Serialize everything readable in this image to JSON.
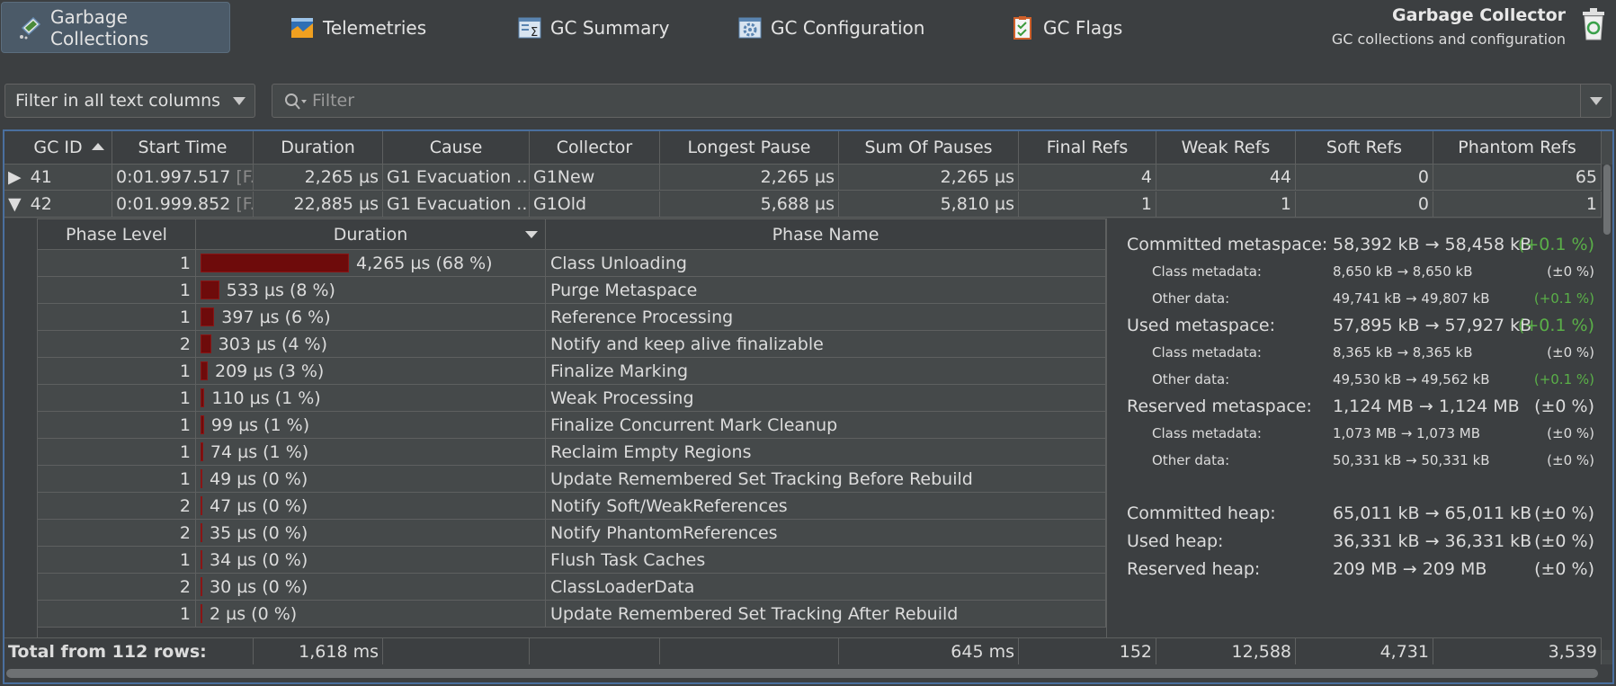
{
  "tabs": [
    {
      "label": "Garbage Collections",
      "icon": "garbage-collections-icon",
      "active": true
    },
    {
      "label": "Telemetries",
      "icon": "telemetries-icon"
    },
    {
      "label": "GC Summary",
      "icon": "gc-summary-icon"
    },
    {
      "label": "GC Configuration",
      "icon": "gc-configuration-icon"
    },
    {
      "label": "GC Flags",
      "icon": "gc-flags-icon"
    }
  ],
  "brand": {
    "title": "Garbage Collector",
    "subtitle": "GC collections and configuration"
  },
  "filter_bar": {
    "mode": "Filter in all text columns",
    "placeholder": "Filter"
  },
  "table": {
    "columns": [
      "GC ID",
      "Start Time",
      "Duration",
      "Cause",
      "Collector",
      "Longest Pause",
      "Sum Of Pauses",
      "Final Refs",
      "Weak Refs",
      "Soft Refs",
      "Phantom Refs"
    ],
    "rows": [
      {
        "gc_id": "41",
        "start_time": "0:01.997.517",
        "start_suffix": "[F...",
        "duration": "2,265 µs",
        "cause": "G1 Evacuation ...",
        "collector": "G1New",
        "longest_pause": "2,265 µs",
        "sum_of_pauses": "2,265 µs",
        "final_refs": "4",
        "weak_refs": "44",
        "soft_refs": "0",
        "phantom_refs": "65"
      },
      {
        "gc_id": "42",
        "start_time": "0:01.999.852",
        "start_suffix": "[F...",
        "duration": "22,885 µs",
        "cause": "G1 Evacuation ...",
        "collector": "G1Old",
        "longest_pause": "5,688 µs",
        "sum_of_pauses": "5,810 µs",
        "final_refs": "1",
        "weak_refs": "1",
        "soft_refs": "0",
        "phantom_refs": "1"
      }
    ],
    "total": {
      "label": "Total from 112 rows:",
      "duration": "1,618 ms",
      "sum_of_pauses": "645 ms",
      "final_refs": "152",
      "weak_refs": "12,588",
      "soft_refs": "4,731",
      "phantom_refs": "3,539"
    }
  },
  "phases": {
    "columns": [
      "Phase Level",
      "Duration",
      "Phase Name"
    ],
    "rows": [
      {
        "level": "1",
        "duration": "4,265 µs (68 %)",
        "share": 68,
        "name": "Class Unloading"
      },
      {
        "level": "1",
        "duration": "533 µs (8 %)",
        "share": 8.5,
        "name": "Purge Metaspace"
      },
      {
        "level": "1",
        "duration": "397 µs (6 %)",
        "share": 6.3,
        "name": "Reference Processing"
      },
      {
        "level": "2",
        "duration": "303 µs (4 %)",
        "share": 4.8,
        "name": "Notify and keep alive finalizable"
      },
      {
        "level": "1",
        "duration": "209 µs (3 %)",
        "share": 3.3,
        "name": "Finalize Marking"
      },
      {
        "level": "1",
        "duration": "110 µs (1 %)",
        "share": 1.8,
        "name": "Weak Processing"
      },
      {
        "level": "1",
        "duration": "99 µs (1 %)",
        "share": 1.6,
        "name": "Finalize Concurrent Mark Cleanup"
      },
      {
        "level": "1",
        "duration": "74 µs (1 %)",
        "share": 1.2,
        "name": "Reclaim Empty Regions"
      },
      {
        "level": "1",
        "duration": "49 µs (0 %)",
        "share": 0.8,
        "name": "Update Remembered Set Tracking Before Rebuild"
      },
      {
        "level": "2",
        "duration": "47 µs (0 %)",
        "share": 0.75,
        "name": "Notify Soft/WeakReferences"
      },
      {
        "level": "2",
        "duration": "35 µs (0 %)",
        "share": 0.56,
        "name": "Notify PhantomReferences"
      },
      {
        "level": "1",
        "duration": "34 µs (0 %)",
        "share": 0.54,
        "name": "Flush Task Caches"
      },
      {
        "level": "2",
        "duration": "30 µs (0 %)",
        "share": 0.48,
        "name": "ClassLoaderData"
      },
      {
        "level": "1",
        "duration": "2 µs (0 %)",
        "share": 0.03,
        "name": "Update Remembered Set Tracking After Rebuild"
      }
    ]
  },
  "metaspace": [
    {
      "label": "Committed metaspace:",
      "value": "58,392 kB → 58,458 kB",
      "pct": "(+0.1 %)",
      "green": true,
      "small": false
    },
    {
      "label": "Class metadata:",
      "value": "8,650 kB → 8,650 kB",
      "pct": "(±0 %)",
      "green": false,
      "small": true
    },
    {
      "label": "Other data:",
      "value": "49,741 kB → 49,807 kB",
      "pct": "(+0.1 %)",
      "green": true,
      "small": true
    },
    {
      "label": "Used metaspace:",
      "value": "57,895 kB → 57,927 kB",
      "pct": "(+0.1 %)",
      "green": true,
      "small": false
    },
    {
      "label": "Class metadata:",
      "value": "8,365 kB → 8,365 kB",
      "pct": "(±0 %)",
      "green": false,
      "small": true
    },
    {
      "label": "Other data:",
      "value": "49,530 kB → 49,562 kB",
      "pct": "(+0.1 %)",
      "green": true,
      "small": true
    },
    {
      "label": "Reserved metaspace:",
      "value": "1,124 MB → 1,124 MB",
      "pct": "(±0 %)",
      "green": false,
      "small": false
    },
    {
      "label": "Class metadata:",
      "value": "1,073 MB → 1,073 MB",
      "pct": "(±0 %)",
      "green": false,
      "small": true
    },
    {
      "label": "Other data:",
      "value": "50,331 kB → 50,331 kB",
      "pct": "(±0 %)",
      "green": false,
      "small": true
    }
  ],
  "heap": [
    {
      "label": "Committed heap:",
      "value": "65,011 kB → 65,011 kB",
      "pct": "(±0 %)"
    },
    {
      "label": "Used heap:",
      "value": "36,331 kB → 36,331 kB",
      "pct": "(±0 %)"
    },
    {
      "label": "Reserved heap:",
      "value": "209 MB → 209 MB",
      "pct": "(±0 %)"
    }
  ],
  "colors": {
    "accent": "#4a6f9e",
    "bar": "#6e0b0b",
    "positive": "#5aaf48"
  }
}
